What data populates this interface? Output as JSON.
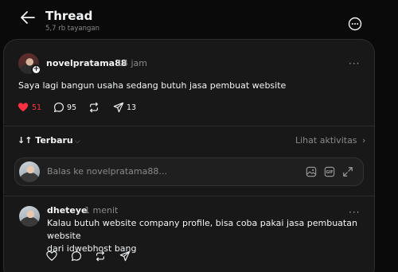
{
  "header": {
    "title": "Thread",
    "views": "5,7 rb tayangan"
  },
  "post": {
    "username": "novelpratama88",
    "time": "14 jam",
    "text": "Saya lagi bangun usaha sedang butuh jasa pembuat website",
    "likes": "51",
    "comments": "95",
    "shares": "13",
    "like_color": "#ff3040"
  },
  "replies_header": {
    "sort_label": "Terbaru",
    "activity_label": "Lihat aktivitas"
  },
  "reply_composer": {
    "placeholder": "Balas ke novelpratama88..."
  },
  "comment": {
    "username": "dheteye",
    "time": "1 menit",
    "text_line1": "Kalau butuh website company profile, bisa coba pakai jasa pembuatan website",
    "text_line2": "dari idwebhost bang"
  }
}
